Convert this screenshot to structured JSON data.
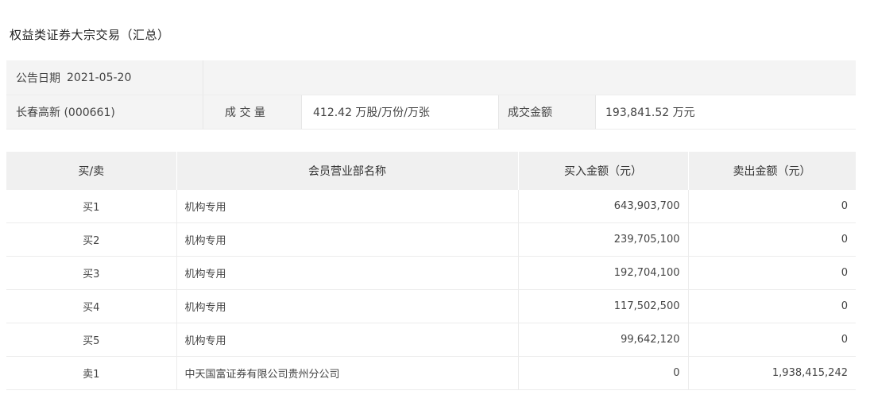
{
  "page": {
    "title": "权益类证券大宗交易（汇总）"
  },
  "summary": {
    "date_label": "公告日期",
    "date_value": "2021-05-20",
    "stock": "长春高新 (000661)",
    "volume_label": "成 交 量",
    "volume_value": "412.42 万股/万份/万张",
    "amount_label": "成交金额",
    "amount_value": "193,841.52 万元"
  },
  "table": {
    "headers": [
      "买/卖",
      "会员营业部名称",
      "买入金额（元）",
      "卖出金额（元）"
    ],
    "rows": [
      {
        "side": "买1",
        "name": "机构专用",
        "buy": "643,903,700",
        "sell": "0"
      },
      {
        "side": "买2",
        "name": "机构专用",
        "buy": "239,705,100",
        "sell": "0"
      },
      {
        "side": "买3",
        "name": "机构专用",
        "buy": "192,704,100",
        "sell": "0"
      },
      {
        "side": "买4",
        "name": "机构专用",
        "buy": "117,502,500",
        "sell": "0"
      },
      {
        "side": "买5",
        "name": "机构专用",
        "buy": "99,642,120",
        "sell": "0"
      },
      {
        "side": "卖1",
        "name": "中天国富证券有限公司贵州分公司",
        "buy": "0",
        "sell": "1,938,415,242"
      }
    ]
  }
}
